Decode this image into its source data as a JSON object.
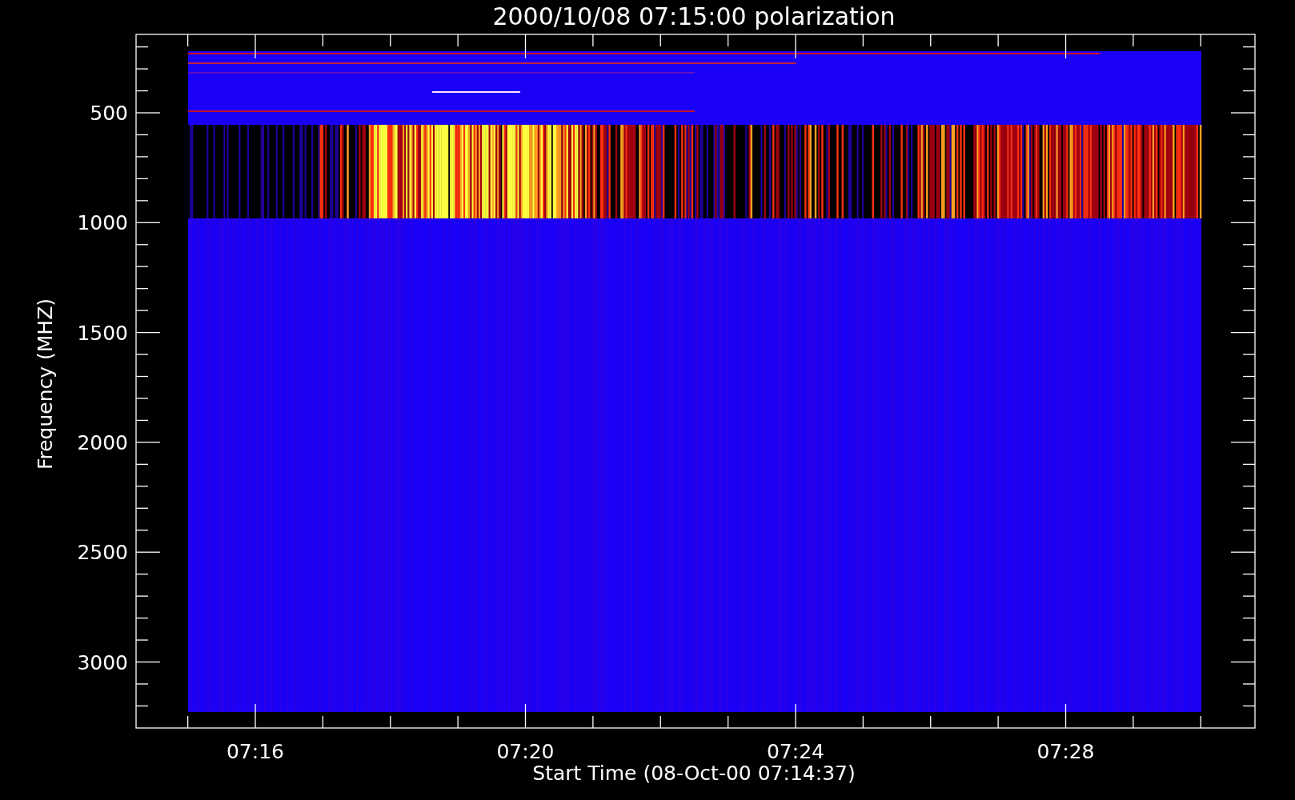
{
  "title": "2000/10/08 07:15:00 polarization",
  "y_axis": {
    "label": "Frequency (MHZ)",
    "ticks": [
      "500",
      "1000",
      "1500",
      "2000",
      "2500",
      "3000"
    ]
  },
  "x_axis": {
    "label": "Start Time (08-Oct-00 07:14:37)",
    "ticks": [
      "07:16",
      "07:20",
      "07:24",
      "07:28"
    ]
  }
}
